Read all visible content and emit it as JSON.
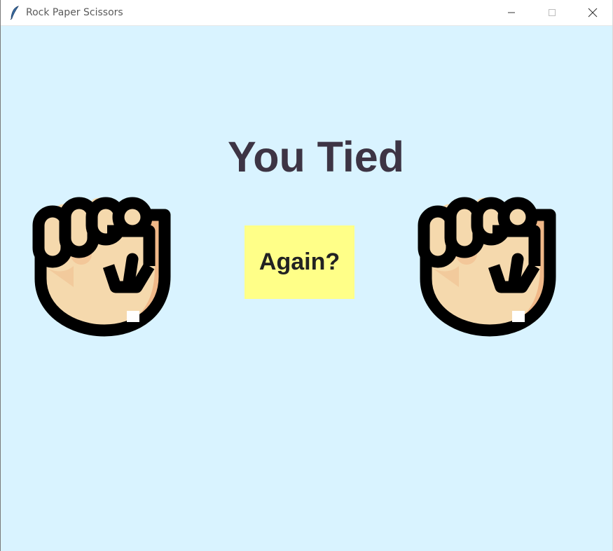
{
  "window": {
    "title": "Rock Paper Scissors",
    "icon": "feather-icon",
    "controls": [
      "minimize-icon",
      "maximize-icon",
      "close-icon"
    ]
  },
  "game": {
    "result_text": "You Tied",
    "again_label": "Again?",
    "player_choice": "rock",
    "computer_choice": "rock"
  },
  "colors": {
    "background": "#d9f3ff",
    "button_bg": "#ffff88",
    "result_text": "#3d3444",
    "skin": "#f5d9ad",
    "skin_shadow": "#f0b888",
    "outline": "#000000"
  }
}
